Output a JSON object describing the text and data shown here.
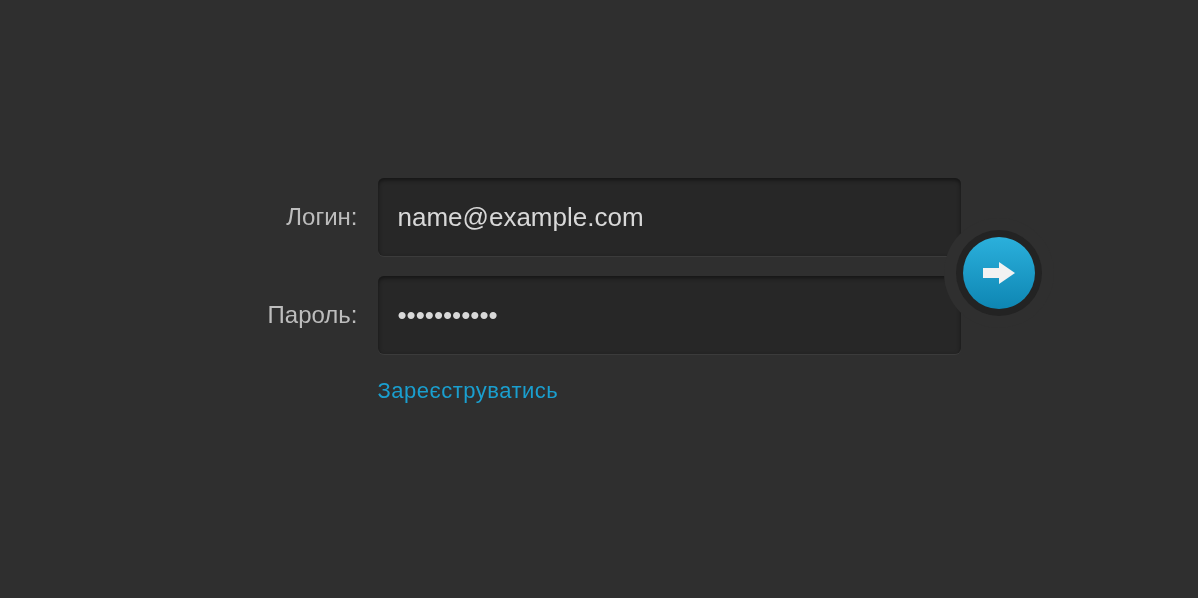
{
  "login_form": {
    "fields": [
      {
        "label": "Логин:",
        "value": "name@example.com"
      },
      {
        "label": "Пароль:",
        "value": "•••••••••••"
      }
    ],
    "register_link": "Зареєструватись"
  }
}
